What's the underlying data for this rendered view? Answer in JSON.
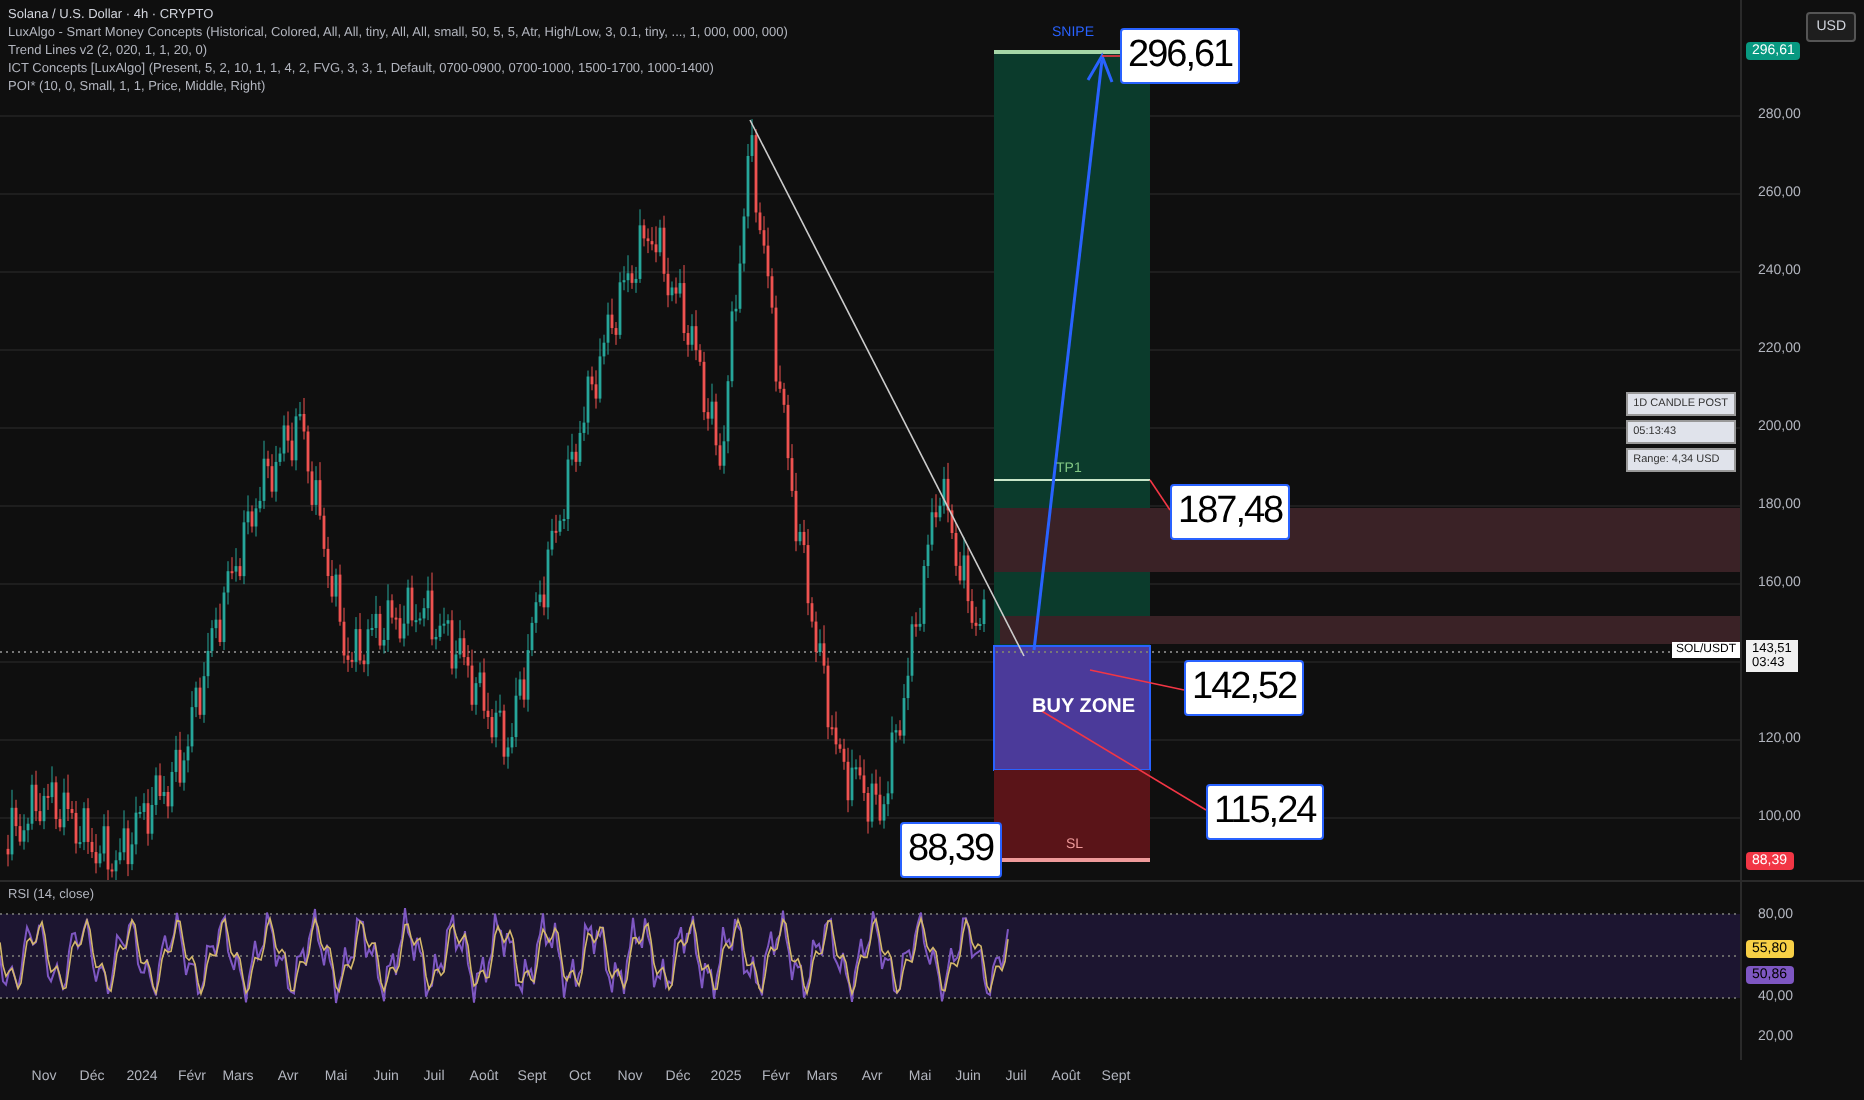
{
  "legend": {
    "symbol": "Solana / U.S. Dollar · 4h · CRYPTO",
    "indicators": [
      "LuxAlgo - Smart Money Concepts (Historical, Colored, All, All, tiny, All, All, small, 50, 5, 5, Atr, High/Low, 3, 0.1, tiny, ..., 1, 000, 000, 000)",
      "Trend Lines v2 (2, 020, 1, 1, 20, 0)",
      "ICT Concepts [LuxAlgo] (Present, 5, 2, 10, 1, 1, 4, 2, FVG, 3, 3, 1, Default, 0700-0900, 0700-1000, 1500-1700, 1000-1400)",
      "POI* (10, 0, Small, 1, 1, Price, Middle, Right)"
    ]
  },
  "currency_button": "USD",
  "price_axis": {
    "ticks": [
      "280,00",
      "260,00",
      "240,00",
      "220,00",
      "200,00",
      "180,00",
      "160,00",
      "120,00",
      "100,00"
    ]
  },
  "price_tags": [
    {
      "text": "296,61",
      "color": "#089981"
    },
    {
      "text": "88,39",
      "color": "#f23645"
    }
  ],
  "last_price": {
    "symbol": "SOL/USDT",
    "price": "143,51",
    "countdown": "03:43"
  },
  "trade_setup": {
    "target_label": "SNIPE",
    "tp_label": "TP1",
    "zone_label": "BUY ZONE",
    "sl_label": "SL"
  },
  "callouts": [
    "296,61",
    "187,48",
    "142,52",
    "115,24",
    "88,39"
  ],
  "info_table": [
    "1D CANDLE POST",
    "05:13:43",
    "Range: 4,34 USD"
  ],
  "rsi": {
    "title": "RSI (14, close)",
    "ticks": [
      "80,00",
      "40,00",
      "20,00"
    ],
    "tags": [
      {
        "text": "55,80",
        "color": "#f7d046"
      },
      {
        "text": "50,86",
        "color": "#7e57c2"
      }
    ]
  },
  "time_axis": [
    "Nov",
    "Déc",
    "2024",
    "Févr",
    "Mars",
    "Avr",
    "Mai",
    "Juin",
    "Juil",
    "Août",
    "Sept",
    "Oct",
    "Nov",
    "Déc",
    "2025",
    "Févr",
    "Mars",
    "Avr",
    "Mai",
    "Juin",
    "Juil",
    "Août",
    "Sept"
  ]
}
